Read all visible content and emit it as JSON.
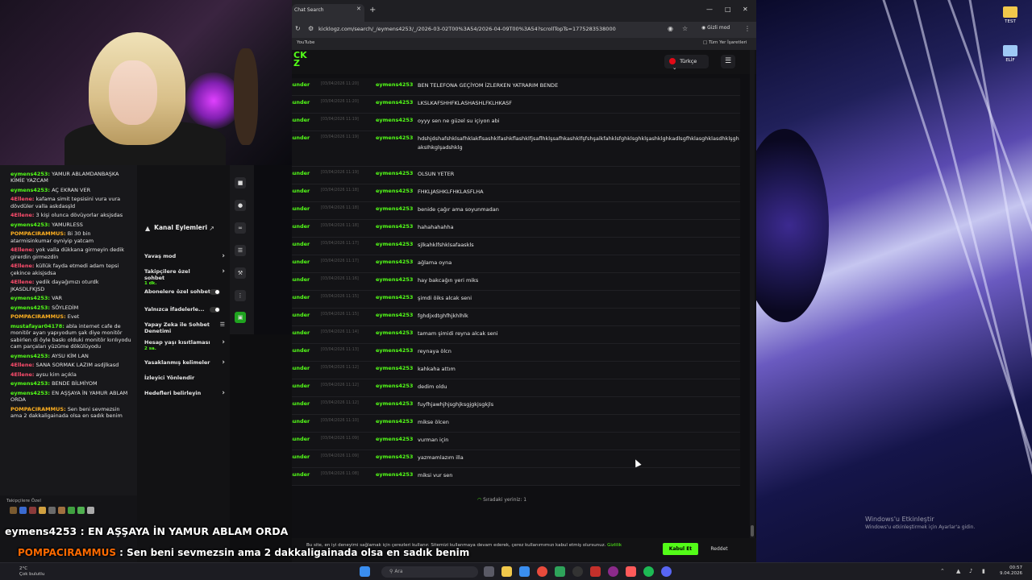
{
  "colors": {
    "kick_green": "#53fc18",
    "panel_bg": "#18181b",
    "overlay_name": "#ff6a00"
  },
  "chat_panel": {
    "messages": [
      {
        "user": "eymens4253:",
        "text": " YAMUR ABLAMDANBAŞKA KİMİE YAZCAM",
        "color": "#53fc18"
      },
      {
        "user": "eymens4253:",
        "text": " AÇ EKRAN VER",
        "color": "#53fc18"
      },
      {
        "user": "4Ellene:",
        "text": " kafama simit tepsisini vura vura dövdüler valla askdasşld",
        "color": "#ff4d6d"
      },
      {
        "user": "4Ellene:",
        "text": " 3 kişi olunca dövüyorlar aksjsdas",
        "color": "#ff4d6d"
      },
      {
        "user": "eymens4253:",
        "text": " YAMURLESS",
        "color": "#53fc18"
      },
      {
        "user": "POMPACIRAMMUS:",
        "text": " Bi 30 bin atarmisinkumar oyniyip yatcam",
        "color": "#ffb020"
      },
      {
        "user": "4Ellene:",
        "text": " yok valla dükkana girmeyin dedik girerdin girmezdin",
        "color": "#ff4d6d"
      },
      {
        "user": "4Ellene:",
        "text": " küllük fayda etmedi adam tepsi çekince akisjsdsa",
        "color": "#ff4d6d"
      },
      {
        "user": "4Ellene:",
        "text": " yedik dayağımızı oturdk JKASDLFKJSD",
        "color": "#ff4d6d"
      },
      {
        "user": "eymens4253:",
        "text": " VAR",
        "color": "#53fc18"
      },
      {
        "user": "eymens4253:",
        "text": " SÖYLEDİM",
        "color": "#53fc18"
      },
      {
        "user": "POMPACIRAMMUS:",
        "text": " Evet",
        "color": "#ffb020"
      },
      {
        "user": "mustafayar04178:",
        "text": " abla internet cafe de monitör ayarı yapıyodum şak diye monitör sabirlen di öyle baskı olduki monitör kırılıyodu cam parçaları yüzüme dökülüyodu",
        "color": "#53fc18"
      },
      {
        "user": "eymens4253:",
        "text": " AYSU KİM LAN",
        "color": "#53fc18"
      },
      {
        "user": "4Ellene:",
        "text": " SANA SORMAK LAZIM asdjlkasd",
        "color": "#ff4d6d"
      },
      {
        "user": "4Ellene:",
        "text": " aysu kim açıkla",
        "color": "#ff4d6d"
      },
      {
        "user": "eymens4253:",
        "text": " BENDE BİLMİYOM",
        "color": "#53fc18"
      },
      {
        "user": "eymens4253:",
        "text": " EN AŞŞAYA İN YAMUR ABLAM ORDA",
        "color": "#53fc18"
      },
      {
        "user": "POMPACIRAMMUS:",
        "text": " Sen beni sevmezsin ama 2 dakkaligainada olsa en sadık benim",
        "color": "#ffb020"
      }
    ],
    "tier_label": "Takipçilere Özel"
  },
  "mod_panel": {
    "title": "Kanal Eylemleri",
    "items": [
      {
        "label": "Yavaş mod",
        "sub": "",
        "control": "chevron"
      },
      {
        "label": "Takipçilere özel sohbet",
        "sub": "1 dk.",
        "control": "chevron"
      },
      {
        "label": "Abonelere özel sohbet",
        "sub": "",
        "control": "toggle"
      },
      {
        "label": "Yalnızca İfadelerle...",
        "sub": "",
        "control": "toggle"
      },
      {
        "label": "Yapay Zeka ile Sohbet Denetimi",
        "sub": "",
        "control": "icon"
      },
      {
        "label": "Hesap yaşı kısıtlaması",
        "sub": "2 sa.",
        "control": "chevron"
      },
      {
        "label": "Yasaklanmış kelimeler",
        "sub": "",
        "control": "chevron"
      },
      {
        "label": "İzleyici Yönlendir",
        "sub": "",
        "control": "none"
      },
      {
        "label": "Hedefleri belirleyin",
        "sub": "",
        "control": "chevron"
      }
    ]
  },
  "browser": {
    "tab_title": "Chat Search",
    "url": "kicklogz.com/search/_/eymens4253/_/2026-03-02T00%3A54/2026-04-09T00%3A54?scrollTopTs=1775283538000",
    "incognito_label": "Gizli mod",
    "bookmark_youtube": "YouTube",
    "bookmark_all": "Tüm Yer İşaretleri",
    "language": "Türkçe",
    "queue_text": "Sıradaki yeriniz: 1",
    "cookie_text": "Bu site, en iyi deneyimi sağlamak için çerezleri kullanır. Sitemizi kullanmaya devam ederek, çerez kullanımımızı kabul etmiş olursunuz.",
    "cookie_link": "Gizlilik",
    "accept_label": "Kabul Et",
    "reject_label": "Reddet"
  },
  "messages": [
    {
      "channel": "imthunder",
      "ts": "[03/04/2026 11:20]",
      "user": "eymens4253",
      "text": "BEN TELEFONA GEÇİYOM İZLERKEN YATRARIM BENDE"
    },
    {
      "channel": "imthunder",
      "ts": "[03/04/2026 11:20]",
      "user": "eymens4253",
      "text": "LKSLKAFSHHFKLASHASHLFKLHKASF"
    },
    {
      "channel": "imthunder",
      "ts": "[03/04/2026 11:19]",
      "user": "eymens4253",
      "text": "oyyy sen ne güzel su içiyon abi"
    },
    {
      "channel": "imthunder",
      "ts": "[03/04/2026 11:19]",
      "user": "eymens4253",
      "text": "hdshjdshafshklsafhklakflsashklfashkflashklfjsaflhklşsafhkashklfşfshşalkfahklsfghklsghklşashklghkadlsgfhklasghklasdhklşghaksIhkglşadshklg"
    },
    {
      "channel": "imthunder",
      "ts": "[03/04/2026 11:19]",
      "user": "eymens4253",
      "text": "OLSUN YETER"
    },
    {
      "channel": "imthunder",
      "ts": "[03/04/2026 11:18]",
      "user": "eymens4253",
      "text": "FHKLJASHKLFHKLASFLHA"
    },
    {
      "channel": "imthunder",
      "ts": "[03/04/2026 11:18]",
      "user": "eymens4253",
      "text": "benide çağır ama soyunmadan"
    },
    {
      "channel": "imthunder",
      "ts": "[03/04/2026 11:18]",
      "user": "eymens4253",
      "text": "hahahahahha"
    },
    {
      "channel": "imthunder",
      "ts": "[03/04/2026 11:17]",
      "user": "eymens4253",
      "text": "sjlkahklfshklsafaaskls"
    },
    {
      "channel": "imthunder",
      "ts": "[03/04/2026 11:17]",
      "user": "eymens4253",
      "text": "ağlama oyna"
    },
    {
      "channel": "imthunder",
      "ts": "[03/04/2026 11:16]",
      "user": "eymens4253",
      "text": "hay bakcağın yeri miks"
    },
    {
      "channel": "imthunder",
      "ts": "[03/04/2026 11:15]",
      "user": "eymens4253",
      "text": "şimdi öiks alcak seni"
    },
    {
      "channel": "imthunder",
      "ts": "[03/04/2026 11:15]",
      "user": "eymens4253",
      "text": "fghdjxdtghfhjkhlhlk"
    },
    {
      "channel": "imthunder",
      "ts": "[03/04/2026 11:14]",
      "user": "eymens4253",
      "text": "tamam şimidi reyna alcak seni"
    },
    {
      "channel": "imthunder",
      "ts": "[03/04/2026 11:13]",
      "user": "eymens4253",
      "text": "reynaya ölcn"
    },
    {
      "channel": "imthunder",
      "ts": "[03/04/2026 11:12]",
      "user": "eymens4253",
      "text": "kahkaha attım"
    },
    {
      "channel": "imthunder",
      "ts": "[03/04/2026 11:12]",
      "user": "eymens4253",
      "text": "dedim oldu"
    },
    {
      "channel": "imthunder",
      "ts": "[03/04/2026 11:12]",
      "user": "eymens4253",
      "text": "fuyfhjawhjhjsghjksgjgkjsgkjls"
    },
    {
      "channel": "imthunder",
      "ts": "[03/04/2026 11:10]",
      "user": "eymens4253",
      "text": "mikse ölcen"
    },
    {
      "channel": "imthunder",
      "ts": "[03/04/2026 11:09]",
      "user": "eymens4253",
      "text": "vurman için"
    },
    {
      "channel": "imthunder",
      "ts": "[03/04/2026 11:09]",
      "user": "eymens4253",
      "text": "yazmamlazım illa"
    },
    {
      "channel": "imthunder",
      "ts": "[03/04/2026 11:08]",
      "user": "eymens4253",
      "text": "miksi vur sen"
    }
  ],
  "overlay": {
    "line1": "eymens4253 : EN AŞŞAYA İN YAMUR ABLAM ORDA",
    "line2_name": "POMPACIRAMMUS",
    "line2_text": " : Sen beni sevmezsin ama 2 dakkaligainada olsa en sadık benim"
  },
  "desktop": {
    "icon1_label": "TEST",
    "icon2_label": "ELİF",
    "watermark_title": "Windows'u Etkinleştir",
    "watermark_sub": "Windows'u etkinleştirmek için Ayarlar'a gidin."
  },
  "taskbar": {
    "weather_temp": "2°C",
    "weather_text": "Çok bulutlu",
    "search_placeholder": "Ara",
    "time": "00:57",
    "date": "9.04.2026"
  }
}
